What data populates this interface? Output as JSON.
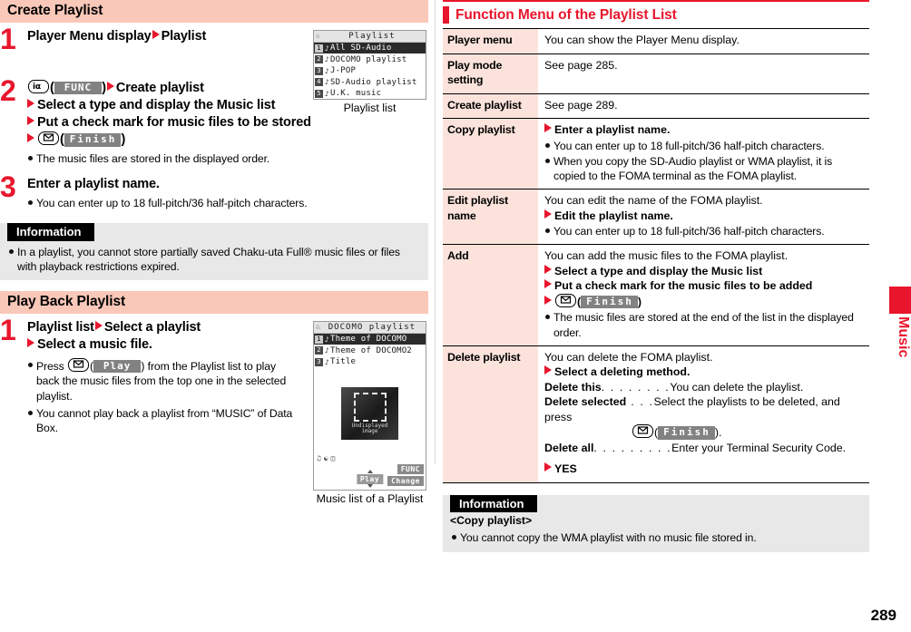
{
  "page": {
    "number": "289",
    "side_tab_label": "Music"
  },
  "left": {
    "section1": {
      "title": "Create Playlist",
      "steps": [
        {
          "num": "1",
          "lines": [
            {
              "parts": [
                {
                  "t": "text",
                  "v": "Player Menu display"
                },
                {
                  "t": "tri"
                },
                {
                  "t": "text",
                  "v": "Playlist"
                }
              ]
            }
          ],
          "bullets": []
        },
        {
          "num": "2",
          "lines": [
            {
              "parts": [
                {
                  "t": "key",
                  "v": "i-mode-func-key"
                },
                {
                  "t": "text",
                  "v": "("
                },
                {
                  "t": "softkey",
                  "v": "FUNC"
                },
                {
                  "t": "text",
                  "v": ")"
                },
                {
                  "t": "tri"
                },
                {
                  "t": "text",
                  "v": "Create playlist"
                }
              ]
            },
            {
              "parts": [
                {
                  "t": "tri"
                },
                {
                  "t": "text",
                  "v": "Select a type and display the Music list"
                }
              ]
            },
            {
              "parts": [
                {
                  "t": "tri"
                },
                {
                  "t": "text",
                  "v": "Put a check mark for music files to be stored"
                }
              ]
            },
            {
              "parts": [
                {
                  "t": "tri"
                },
                {
                  "t": "key",
                  "v": "mail-key"
                },
                {
                  "t": "text",
                  "v": "("
                },
                {
                  "t": "softkey",
                  "v": "Finish"
                },
                {
                  "t": "text",
                  "v": ")"
                }
              ]
            }
          ],
          "bullets": [
            "The music files are stored in the displayed order."
          ]
        },
        {
          "num": "3",
          "lines": [
            {
              "parts": [
                {
                  "t": "text",
                  "v": "Enter a playlist name."
                }
              ]
            }
          ],
          "bullets": [
            "You can enter up to 18 full-pitch/36 half-pitch characters."
          ]
        }
      ],
      "information": {
        "tag": "Information",
        "bullets": [
          "In a playlist, you cannot store partially saved Chaku-uta Full® music files or files with playback restrictions expired."
        ]
      },
      "screenshot": {
        "caption": "Playlist list",
        "title": "Playlist",
        "rows": [
          {
            "idx": "1",
            "label": "All SD-Audio",
            "selected": true
          },
          {
            "idx": "2",
            "label": "DOCOMO playlist",
            "selected": false
          },
          {
            "idx": "3",
            "label": "J-POP",
            "selected": false
          },
          {
            "idx": "4",
            "label": "SD-Audio playlist",
            "selected": false
          },
          {
            "idx": "5",
            "label": "U.K. music",
            "selected": false
          }
        ]
      }
    },
    "section2": {
      "title": "Play Back Playlist",
      "steps": [
        {
          "num": "1",
          "lines": [
            {
              "parts": [
                {
                  "t": "text",
                  "v": "Playlist list"
                },
                {
                  "t": "tri"
                },
                {
                  "t": "text",
                  "v": "Select a playlist"
                }
              ]
            },
            {
              "parts": [
                {
                  "t": "tri"
                },
                {
                  "t": "text",
                  "v": "Select a music file."
                }
              ]
            }
          ],
          "bullets_rich": [
            {
              "pre": "Press ",
              "key": "mail-key",
              "mid": "(",
              "softkey": "Play",
              "post": ") from the Playlist list to play back the music files from the top one in the selected playlist."
            }
          ],
          "bullets": [
            "You cannot play back a playlist from “MUSIC” of Data Box."
          ]
        }
      ],
      "screenshot": {
        "caption": "Music list of a Playlist",
        "title": "DOCOMO playlist",
        "rows": [
          {
            "idx": "1",
            "label": "Theme of DOCOMO",
            "selected": true
          },
          {
            "idx": "2",
            "label": "Theme of DOCOMO2",
            "selected": false
          },
          {
            "idx": "3",
            "label": "Title",
            "selected": false
          }
        ],
        "art_label_line1": "Undisplayed",
        "art_label_line2": "image",
        "softkeys": {
          "func": "FUNC",
          "change": "Change",
          "play": "Play"
        }
      }
    }
  },
  "right": {
    "heading": "Function Menu of the Playlist List",
    "table": {
      "rows": [
        {
          "key": "Player menu",
          "plain": [
            "You can show the Player Menu display."
          ]
        },
        {
          "key": "Play mode setting",
          "plain": [
            "See page 285."
          ]
        },
        {
          "key": "Create playlist",
          "plain": [
            "See page 289."
          ]
        },
        {
          "key": "Copy playlist",
          "steps": [
            "Enter a playlist name."
          ],
          "bullets": [
            "You can enter up to 18 full-pitch/36 half-pitch characters.",
            "When you copy the SD-Audio playlist or WMA playlist, it is copied to the FOMA terminal as the FOMA playlist."
          ]
        },
        {
          "key": "Edit playlist name",
          "plain": [
            "You can edit the name of the FOMA playlist."
          ],
          "steps": [
            "Edit the playlist name."
          ],
          "bullets": [
            "You can enter up to 18 full-pitch/36 half-pitch characters."
          ]
        },
        {
          "key": "Add",
          "plain": [
            "You can add the music files to the FOMA playlist."
          ],
          "steps": [
            "Select a type and display the Music list",
            "Put a check mark for the music files to be added"
          ],
          "key_step": {
            "key": "mail-key",
            "softkey": "Finish"
          },
          "bullets": [
            "The music files are stored at the end of the list in the displayed order."
          ]
        },
        {
          "key": "Delete playlist",
          "plain": [
            "You can delete the FOMA playlist."
          ],
          "steps": [
            "Select a deleting method."
          ],
          "deflist": [
            {
              "label": "Delete this",
              "dots": ". . . . . . . .",
              "desc": "You can delete the playlist."
            },
            {
              "label": "Delete selected",
              "dots": " . . .",
              "desc": "Select the playlists to be deleted, and press"
            },
            {
              "label": "Delete all",
              "dots": ". . . . . . . . .",
              "desc": "Enter your Terminal Security Code."
            }
          ],
          "hang_key": {
            "key": "mail-key",
            "softkey": "Finish",
            "tail": "."
          },
          "final_step": "YES"
        }
      ]
    },
    "information": {
      "tag": "Information",
      "subtitle": "<Copy playlist>",
      "bullets": [
        "You cannot copy the WMA playlist with no music file stored in."
      ]
    }
  }
}
